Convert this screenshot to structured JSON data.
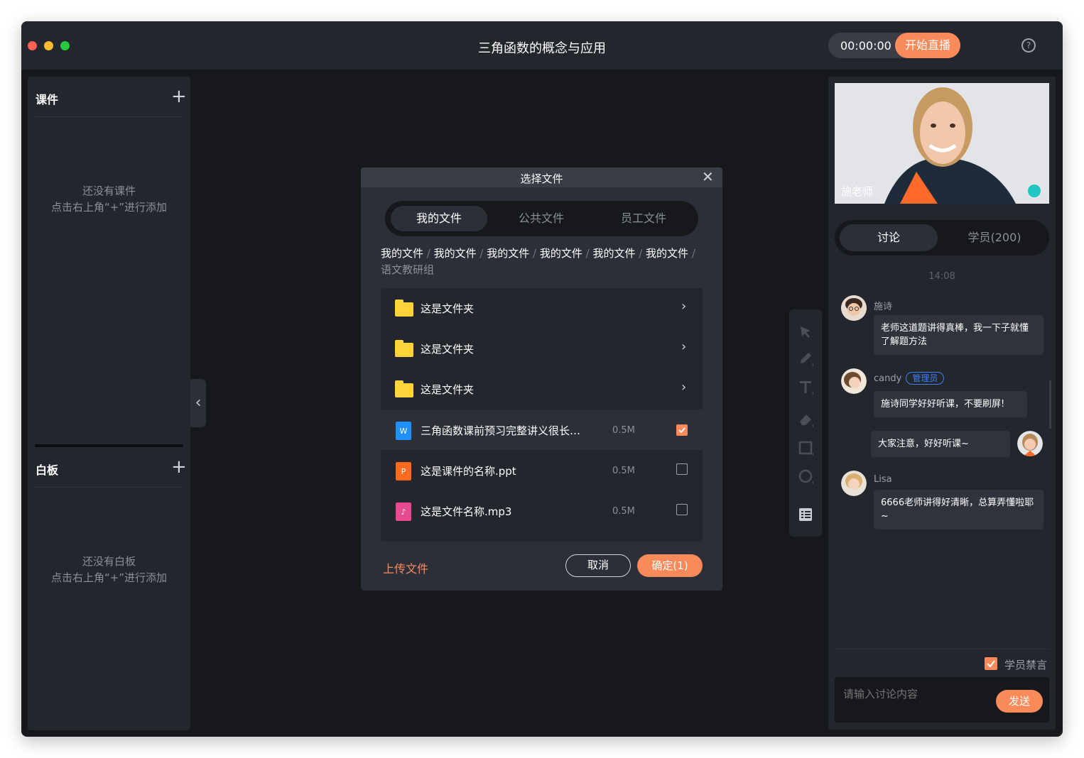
{
  "window": {
    "title": "三角函数的概念与应用",
    "timer": "00:00:00",
    "live_button": "开始直播"
  },
  "left": {
    "courseware": {
      "title": "课件",
      "empty_line1": "还没有课件",
      "empty_line2": "点击右上角“+”进行添加"
    },
    "whiteboard": {
      "title": "白板",
      "empty_line1": "还没有白板",
      "empty_line2": "点击右上角“+”进行添加"
    }
  },
  "dialog": {
    "title": "选择文件",
    "tabs": [
      "我的文件",
      "公共文件",
      "员工文件"
    ],
    "active_tab": 0,
    "breadcrumb": [
      "我的文件",
      "我的文件",
      "我的文件",
      "我的文件",
      "我的文件",
      "我的文件",
      "语文教研组"
    ],
    "folders": [
      "这是文件夹",
      "这是文件夹",
      "这是文件夹"
    ],
    "files": [
      {
        "name": "三角函数课前预习完整讲义很长…",
        "icon_letter": "W",
        "icon": "word-file-icon",
        "color": "#1e90ff",
        "size": "0.5M",
        "checked": true
      },
      {
        "name": "这是课件的名称.ppt",
        "icon_letter": "P",
        "icon": "ppt-file-icon",
        "color": "#ff6a1f",
        "size": "0.5M",
        "checked": false
      },
      {
        "name": "这是文件名称.mp3",
        "icon_letter": "♪",
        "icon": "audio-file-icon",
        "color": "#e84a8f",
        "size": "0.5M",
        "checked": false
      }
    ],
    "upload": "上传文件",
    "cancel": "取消",
    "confirm": "确定(1)"
  },
  "right": {
    "teacher_name": "施老师",
    "tabs": [
      "讨论",
      "学员(200)"
    ],
    "chat_time": "14:08",
    "messages": [
      {
        "name": "施诗",
        "text": "老师这道题讲得真棒，我一下子就懂了解题方法"
      },
      {
        "name": "candy",
        "badge": "管理员",
        "text": "施诗同学好好听课，不要刷屏!"
      },
      {
        "self": true,
        "text": "大家注意，好好听课~"
      },
      {
        "name": "Lisa",
        "text": "6666老师讲得好清晰，总算弄懂啦耶~"
      }
    ],
    "mute_label": "学员禁言",
    "input_placeholder": "请输入讨论内容",
    "send": "发送"
  },
  "colors": {
    "accent": "#fa8a5a",
    "panel": "#23262d",
    "background": "#17181c",
    "admin_badge": "#3b82f6"
  }
}
